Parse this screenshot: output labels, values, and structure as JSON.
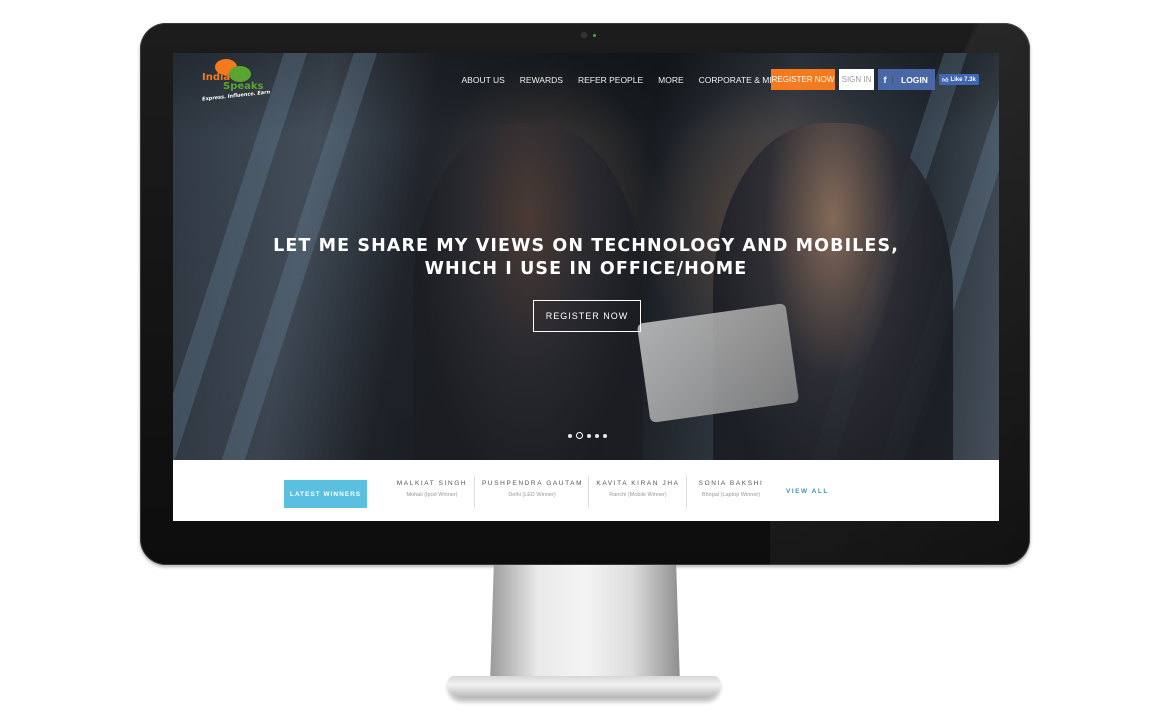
{
  "logo": {
    "line1": "India",
    "line2": "Speaks",
    "tagline": "Express. Influence. Earn"
  },
  "nav": {
    "items": [
      "ABOUT US",
      "REWARDS",
      "REFER PEOPLE",
      "MORE",
      "CORPORATE & MEDIA"
    ]
  },
  "header_actions": {
    "register_label": "REGISTER NOW",
    "signin_label": "SIGN IN",
    "facebook_glyph": "f",
    "login_label": "LOGIN",
    "like_label": "Like 7.3k"
  },
  "hero": {
    "headline": "LET ME SHARE MY VIEWS ON TECHNOLOGY AND MOBILES, WHICH I USE IN OFFICE/HOME",
    "cta_label": "REGISTER NOW",
    "slide_count": 5,
    "active_slide": 2
  },
  "winners": {
    "section_label": "LATEST WINNERS",
    "items": [
      {
        "name": "MALKIAT SINGH",
        "meta": "Mohali (Ipod Winner)"
      },
      {
        "name": "PUSHPENDRA GAUTAM",
        "meta": "Delhi (LED Winner)"
      },
      {
        "name": "KAVITA KIRAN JHA",
        "meta": "Ranchi (Mobile Winner)"
      },
      {
        "name": "SONIA BAKSHI",
        "meta": "Bhopal (Laptop Winner)"
      }
    ],
    "view_all_label": "VIEW ALL"
  },
  "colors": {
    "accent_orange": "#f37a1f",
    "accent_green": "#5aa532",
    "facebook_blue": "#4a67a5",
    "winners_blue": "#5bbfe0",
    "link_blue": "#4a8fb3"
  }
}
